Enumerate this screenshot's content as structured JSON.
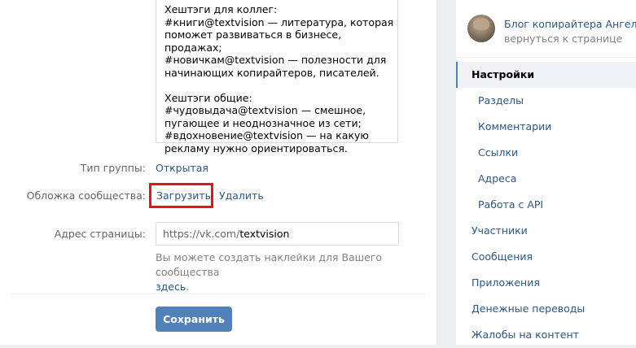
{
  "description_text": "Хештэги для коллег:\n#книги@textvision — литература, которая поможет развиваться в бизнесе, продажах;\n#новичкам@textvision — полезности для начинающих копирайтеров, писателей.\n\nХештэги общие:\n#чудовыдача@textvision — смешное, пугающее и неоднозначное из сети;\n#вдохновение@textvision — на какую рекламу нужно ориентироваться.",
  "group_type": {
    "label": "Тип группы:",
    "value": "Открытая"
  },
  "cover": {
    "label": "Обложка сообщества:",
    "upload": "Загрузить",
    "separator": "·",
    "delete": "Удалить"
  },
  "address": {
    "label": "Адрес страницы:",
    "prefix": "https://vk.com/",
    "value": "textvision",
    "note": "Вы можете создать наклейки для Вашего сообщества",
    "note_link": "здесь",
    "note_end": "."
  },
  "save_label": "Сохранить",
  "sidebar": {
    "group_name": "Блог копирайтера Ангел...",
    "back_link": "вернуться к странице",
    "items": [
      {
        "label": "Настройки",
        "active": true
      },
      {
        "label": "Разделы",
        "sub": true
      },
      {
        "label": "Комментарии",
        "sub": true
      },
      {
        "label": "Ссылки",
        "sub": true
      },
      {
        "label": "Адреса",
        "sub": true
      },
      {
        "label": "Работа с API",
        "sub": true
      },
      {
        "label": "Участники"
      },
      {
        "label": "Сообщения"
      },
      {
        "label": "Приложения"
      },
      {
        "label": "Денежные переводы"
      },
      {
        "label": "Жалобы на контент"
      }
    ]
  },
  "colors": {
    "accent": "#5181b8",
    "link": "#2a5885",
    "highlight": "#e0161e"
  }
}
